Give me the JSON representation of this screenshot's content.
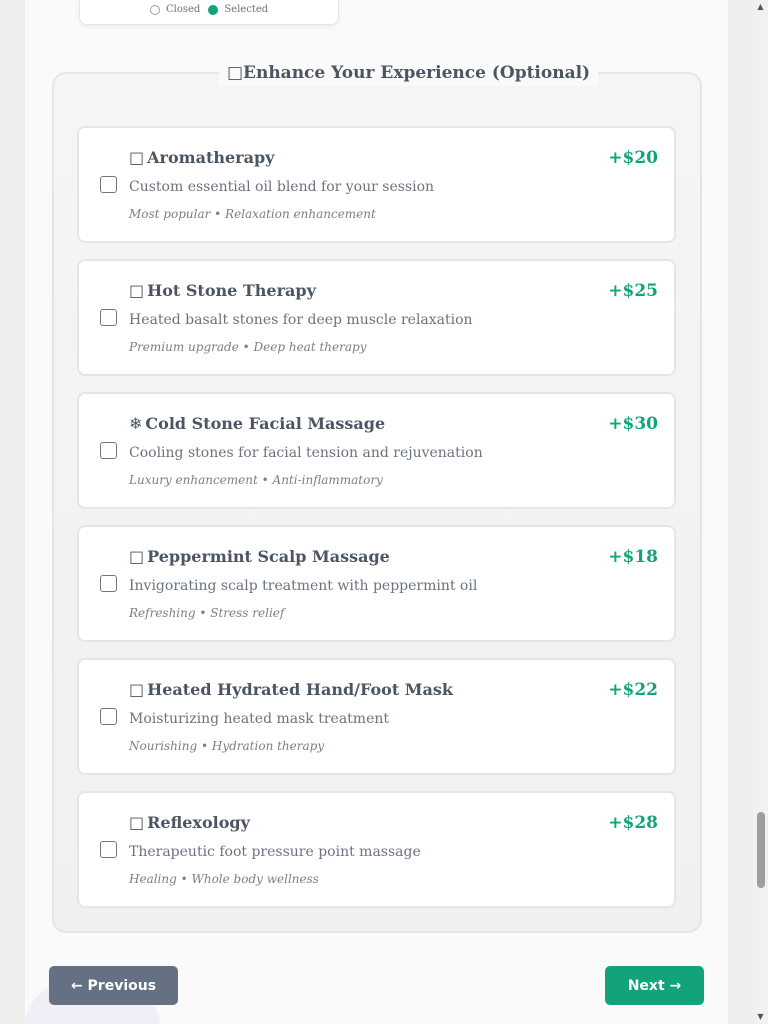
{
  "legend_card": {
    "closed_label": "Closed",
    "selected_label": "Selected"
  },
  "addons": {
    "legend_icon": "□",
    "legend_title": "Enhance Your Experience (Optional)",
    "items": [
      {
        "icon": "□",
        "name": "Aromatherapy",
        "price": "+$20",
        "description": "Custom essential oil blend for your session",
        "meta": "Most popular • Relaxation enhancement"
      },
      {
        "icon": "□",
        "name": "Hot Stone Therapy",
        "price": "+$25",
        "description": "Heated basalt stones for deep muscle relaxation",
        "meta": "Premium upgrade • Deep heat therapy"
      },
      {
        "icon": "❄",
        "name": "Cold Stone Facial Massage",
        "price": "+$30",
        "description": "Cooling stones for facial tension and rejuvenation",
        "meta": "Luxury enhancement • Anti-inflammatory"
      },
      {
        "icon": "□",
        "name": "Peppermint Scalp Massage",
        "price": "+$18",
        "description": "Invigorating scalp treatment with peppermint oil",
        "meta": "Refreshing • Stress relief"
      },
      {
        "icon": "□",
        "name": "Heated Hydrated Hand/Foot Mask",
        "price": "+$22",
        "description": "Moisturizing heated mask treatment",
        "meta": "Nourishing • Hydration therapy"
      },
      {
        "icon": "□",
        "name": "Reflexology",
        "price": "+$28",
        "description": "Therapeutic foot pressure point massage",
        "meta": "Healing • Whole body wellness"
      }
    ]
  },
  "nav": {
    "previous_label": "← Previous",
    "next_label": "Next →"
  },
  "colors": {
    "accent": "#12a37a",
    "secondary_button": "#657083"
  }
}
